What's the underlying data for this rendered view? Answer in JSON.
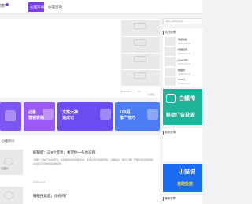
{
  "header": {
    "logo_fragment": "搜广",
    "nav": [
      {
        "label": "心理资讯"
      },
      {
        "label": "心理咨询"
      }
    ]
  },
  "hero": {
    "thumbs": [
      {
        "caption": ""
      },
      {
        "caption": ""
      },
      {
        "caption": ""
      },
      {
        "caption": ""
      }
    ],
    "meta_date": "2019-12-11",
    "meta_count": "21",
    "meta_more": "…",
    "meta_tag": "好阅读"
  },
  "cards": [
    {
      "line1": "必备",
      "line2": "营销套路",
      "color": "#9b59f5"
    },
    {
      "line1": "文案大神",
      "line2": "速成记",
      "color": "#6a4cf0"
    },
    {
      "line1": "100招",
      "line2": "推广技巧",
      "color": "#4e7cf5"
    }
  ],
  "list": {
    "heading": "心理资讯",
    "items": [
      {
        "thumb_caption": "无图片",
        "title": "抑郁症：这9个症状，希望你一条也没有",
        "desc": "“抑郁”一词在日常中更近。在抑郁症的具体症状中，患者表现为情绪低落，兴趣丧失，精力下降，严重时会出现自伤，并且还有可能伴随其他症状。",
        "date": "2019-12-11"
      },
      {
        "thumb_caption": "",
        "title": "睡眠拖延症，你有吗？",
        "desc": "",
        "date": ""
      }
    ]
  },
  "sidebar": {
    "search_placeholder": "输入关键词搜索…",
    "hot_heading": "热门文章",
    "hot": [
      {
        "title": "情绪的秘…",
        "date": "2019-12-11"
      },
      {
        "title": "婚姻出现…",
        "date": "2019-12-11"
      },
      {
        "title": "Love who…",
        "date": "2019-12-11"
      },
      {
        "title": "婚姻的…",
        "date": "2019-12-11"
      },
      {
        "title": "2021人…",
        "date": "2019-12-11"
      }
    ],
    "ad1_big": "白蝶传",
    "ad1_sub": "移动广告投放",
    "rec_heading": "推荐文章",
    "ad2_big": "小猫说",
    "ad2_sub": "自助投放",
    "latest_heading": "最新文章",
    "latest": [
      {
        "title": "情绪的…",
        "date": ""
      }
    ]
  },
  "colors": {
    "accent": "#7a3ff0",
    "ad1": "#1eb49a",
    "ad2": "#1a6cf0"
  }
}
